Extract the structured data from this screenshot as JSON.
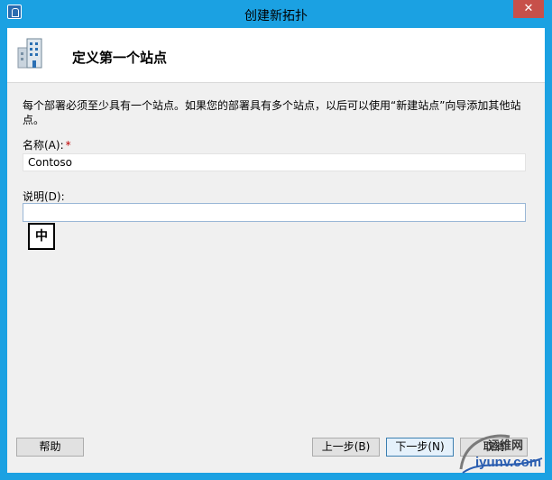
{
  "window": {
    "title": "创建新拓扑",
    "close_glyph": "✕"
  },
  "header": {
    "title": "定义第一个站点",
    "icon": "building-icon"
  },
  "body": {
    "description": "每个部署必须至少具有一个站点。如果您的部署具有多个站点，以后可以使用“新建站点”向导添加其他站点。",
    "name_label": "名称(A):",
    "required_mark": "*",
    "name_value": "Contoso",
    "desc_label": "说明(D):",
    "desc_value": "",
    "ime_indicator": "中"
  },
  "buttons": {
    "help": "帮助",
    "prev": "上一步(B)",
    "next": "下一步(N)",
    "cancel": "取消"
  },
  "watermark": {
    "text_cn": "运维网",
    "domain": "iyunv.com"
  },
  "colors": {
    "title_bar": "#1ba1e2",
    "close_button": "#c7504a",
    "dialog_bg": "#f0f0f0",
    "required": "#c00000"
  }
}
